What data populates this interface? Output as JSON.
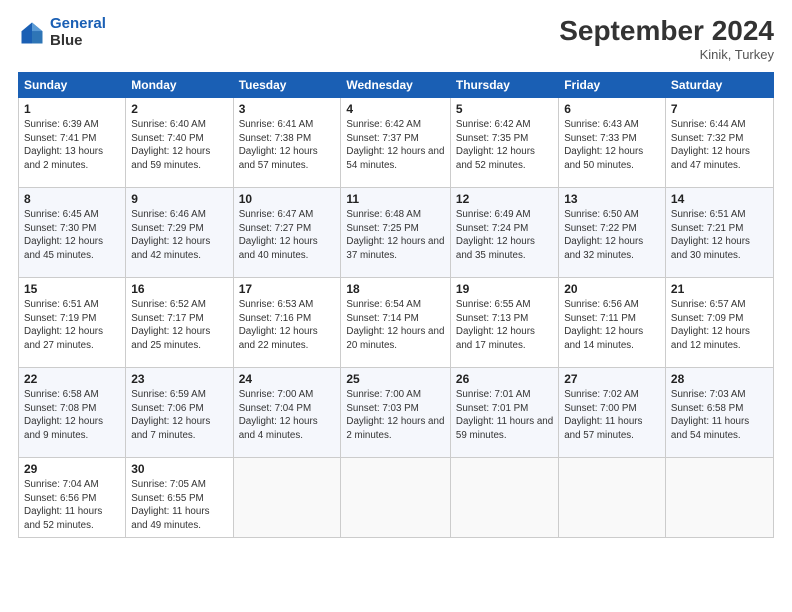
{
  "header": {
    "logo_line1": "General",
    "logo_line2": "Blue",
    "month": "September 2024",
    "location": "Kinik, Turkey"
  },
  "weekdays": [
    "Sunday",
    "Monday",
    "Tuesday",
    "Wednesday",
    "Thursday",
    "Friday",
    "Saturday"
  ],
  "weeks": [
    [
      {
        "day": 1,
        "rise": "6:39 AM",
        "set": "7:41 PM",
        "daylight": "13 hours and 2 minutes."
      },
      {
        "day": 2,
        "rise": "6:40 AM",
        "set": "7:40 PM",
        "daylight": "12 hours and 59 minutes."
      },
      {
        "day": 3,
        "rise": "6:41 AM",
        "set": "7:38 PM",
        "daylight": "12 hours and 57 minutes."
      },
      {
        "day": 4,
        "rise": "6:42 AM",
        "set": "7:37 PM",
        "daylight": "12 hours and 54 minutes."
      },
      {
        "day": 5,
        "rise": "6:42 AM",
        "set": "7:35 PM",
        "daylight": "12 hours and 52 minutes."
      },
      {
        "day": 6,
        "rise": "6:43 AM",
        "set": "7:33 PM",
        "daylight": "12 hours and 50 minutes."
      },
      {
        "day": 7,
        "rise": "6:44 AM",
        "set": "7:32 PM",
        "daylight": "12 hours and 47 minutes."
      }
    ],
    [
      {
        "day": 8,
        "rise": "6:45 AM",
        "set": "7:30 PM",
        "daylight": "12 hours and 45 minutes."
      },
      {
        "day": 9,
        "rise": "6:46 AM",
        "set": "7:29 PM",
        "daylight": "12 hours and 42 minutes."
      },
      {
        "day": 10,
        "rise": "6:47 AM",
        "set": "7:27 PM",
        "daylight": "12 hours and 40 minutes."
      },
      {
        "day": 11,
        "rise": "6:48 AM",
        "set": "7:25 PM",
        "daylight": "12 hours and 37 minutes."
      },
      {
        "day": 12,
        "rise": "6:49 AM",
        "set": "7:24 PM",
        "daylight": "12 hours and 35 minutes."
      },
      {
        "day": 13,
        "rise": "6:50 AM",
        "set": "7:22 PM",
        "daylight": "12 hours and 32 minutes."
      },
      {
        "day": 14,
        "rise": "6:51 AM",
        "set": "7:21 PM",
        "daylight": "12 hours and 30 minutes."
      }
    ],
    [
      {
        "day": 15,
        "rise": "6:51 AM",
        "set": "7:19 PM",
        "daylight": "12 hours and 27 minutes."
      },
      {
        "day": 16,
        "rise": "6:52 AM",
        "set": "7:17 PM",
        "daylight": "12 hours and 25 minutes."
      },
      {
        "day": 17,
        "rise": "6:53 AM",
        "set": "7:16 PM",
        "daylight": "12 hours and 22 minutes."
      },
      {
        "day": 18,
        "rise": "6:54 AM",
        "set": "7:14 PM",
        "daylight": "12 hours and 20 minutes."
      },
      {
        "day": 19,
        "rise": "6:55 AM",
        "set": "7:13 PM",
        "daylight": "12 hours and 17 minutes."
      },
      {
        "day": 20,
        "rise": "6:56 AM",
        "set": "7:11 PM",
        "daylight": "12 hours and 14 minutes."
      },
      {
        "day": 21,
        "rise": "6:57 AM",
        "set": "7:09 PM",
        "daylight": "12 hours and 12 minutes."
      }
    ],
    [
      {
        "day": 22,
        "rise": "6:58 AM",
        "set": "7:08 PM",
        "daylight": "12 hours and 9 minutes."
      },
      {
        "day": 23,
        "rise": "6:59 AM",
        "set": "7:06 PM",
        "daylight": "12 hours and 7 minutes."
      },
      {
        "day": 24,
        "rise": "7:00 AM",
        "set": "7:04 PM",
        "daylight": "12 hours and 4 minutes."
      },
      {
        "day": 25,
        "rise": "7:00 AM",
        "set": "7:03 PM",
        "daylight": "12 hours and 2 minutes."
      },
      {
        "day": 26,
        "rise": "7:01 AM",
        "set": "7:01 PM",
        "daylight": "11 hours and 59 minutes."
      },
      {
        "day": 27,
        "rise": "7:02 AM",
        "set": "7:00 PM",
        "daylight": "11 hours and 57 minutes."
      },
      {
        "day": 28,
        "rise": "7:03 AM",
        "set": "6:58 PM",
        "daylight": "11 hours and 54 minutes."
      }
    ],
    [
      {
        "day": 29,
        "rise": "7:04 AM",
        "set": "6:56 PM",
        "daylight": "11 hours and 52 minutes."
      },
      {
        "day": 30,
        "rise": "7:05 AM",
        "set": "6:55 PM",
        "daylight": "11 hours and 49 minutes."
      },
      null,
      null,
      null,
      null,
      null
    ]
  ]
}
